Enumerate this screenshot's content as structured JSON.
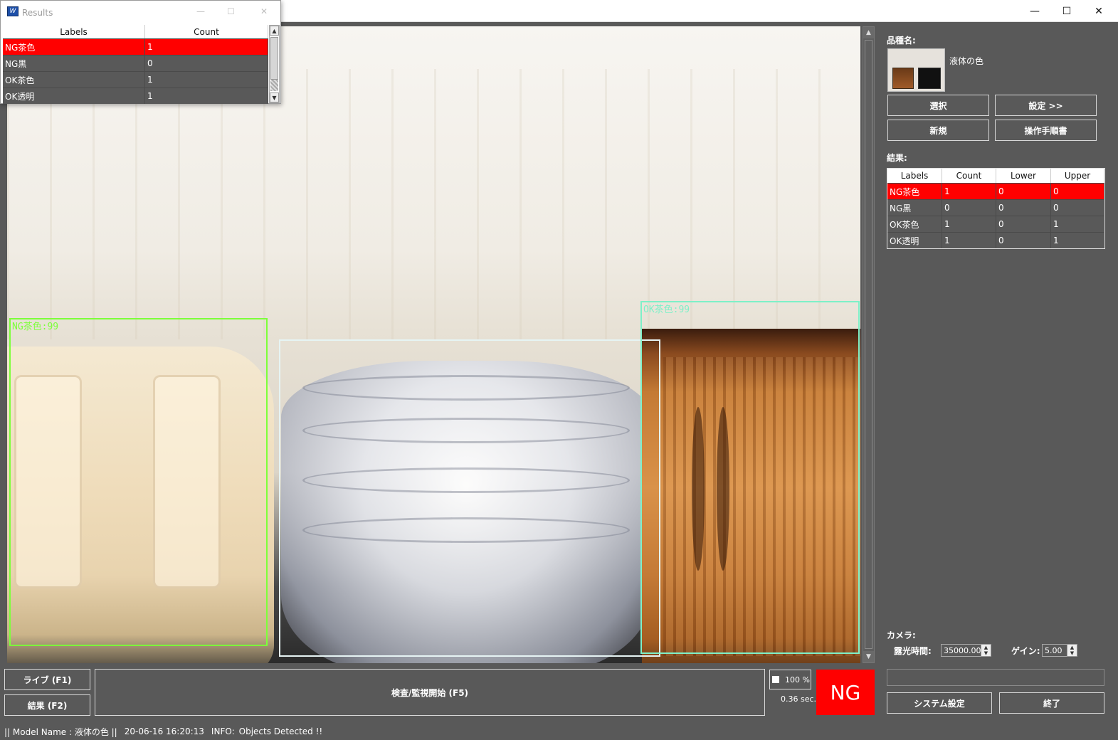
{
  "window": {
    "minimize_glyph": "—",
    "maximize_glyph": "☐",
    "close_glyph": "✕"
  },
  "results_window": {
    "title": "Results",
    "icon_text": "W",
    "minimize_glyph": "—",
    "maximize_glyph": "☐",
    "close_glyph": "✕",
    "columns": [
      "Labels",
      "Count"
    ],
    "rows": [
      {
        "label": "NG茶色",
        "count": "1",
        "selected": true
      },
      {
        "label": "NG黒",
        "count": "0"
      },
      {
        "label": "OK茶色",
        "count": "1"
      },
      {
        "label": "OK透明",
        "count": "1"
      }
    ]
  },
  "viewport": {
    "detections": [
      {
        "label": "NG茶色:99",
        "color": "#7dff3a"
      },
      {
        "label": "",
        "color": "#e6f4f4"
      },
      {
        "label": "OK茶色:99",
        "color": "#7ef0c8"
      }
    ]
  },
  "product": {
    "label": "品種名:",
    "name": "液体の色",
    "buttons": {
      "select": "選択",
      "settings": "設定 >>",
      "new": "新規",
      "manual": "操作手順書"
    }
  },
  "results": {
    "label": "結果:",
    "columns": [
      "Labels",
      "Count",
      "Lower",
      "Upper"
    ],
    "rows": [
      {
        "label": "NG茶色",
        "count": "1",
        "lower": "0",
        "upper": "0",
        "selected": true
      },
      {
        "label": "NG黒",
        "count": "0",
        "lower": "0",
        "upper": "0"
      },
      {
        "label": "OK茶色",
        "count": "1",
        "lower": "0",
        "upper": "1"
      },
      {
        "label": "OK透明",
        "count": "1",
        "lower": "0",
        "upper": "1"
      }
    ]
  },
  "camera": {
    "label": "カメラ:",
    "exposure_label": "露光時間:",
    "exposure_value": "35000.00",
    "gain_label": "ゲイン:",
    "gain_value": "5.00"
  },
  "bottom": {
    "live_button": "ライブ (F1)",
    "result_button": "結果 (F2)",
    "inspect_button": "検査/監視開始 (F5)",
    "zoom": "100 %",
    "time": "0.36 sec.",
    "status": "NG",
    "status_color": "#ff0000",
    "system_button": "システム設定",
    "exit_button": "終了"
  },
  "statusbar": {
    "model": "|| Model Name : 液体の色 ||",
    "datetime": "20-06-16 16:20:13",
    "info_label": "INFO:",
    "info_text": "Objects Detected !!"
  }
}
